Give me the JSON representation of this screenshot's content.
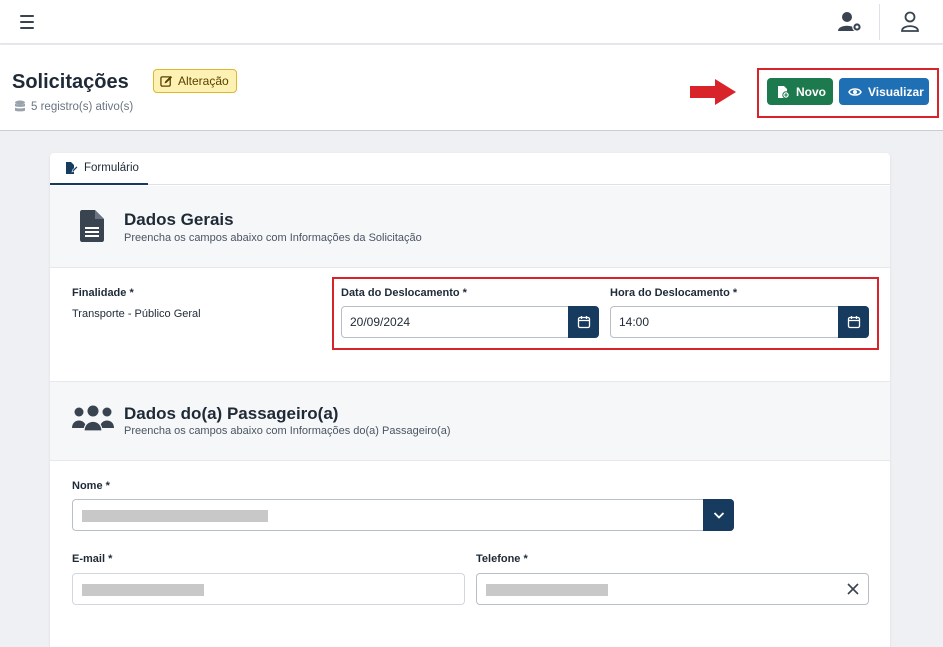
{
  "header": {
    "menu_icon": "hamburger-icon",
    "settings_icon": "user-gear-icon",
    "user_icon": "user-icon"
  },
  "page": {
    "title": "Solicitações",
    "badge_label": "Alteração",
    "records_info": "5 registro(s) ativo(s)",
    "actions": {
      "novo_label": "Novo",
      "visualizar_label": "Visualizar"
    }
  },
  "tabs": [
    {
      "label": "Formulário",
      "active": true
    }
  ],
  "dados_gerais": {
    "title": "Dados Gerais",
    "subtitle": "Preencha os campos abaixo com Informações da Solicitação",
    "finalidade_label": "Finalidade *",
    "finalidade_value": "Transporte - Público Geral",
    "data_label": "Data do Deslocamento *",
    "data_value": "20/09/2024",
    "hora_label": "Hora do Deslocamento *",
    "hora_value": "14:00"
  },
  "passageiro": {
    "title": "Dados do(a) Passageiro(a)",
    "subtitle": "Preencha os campos abaixo com Informações do(a) Passageiro(a)",
    "nome_label": "Nome *",
    "email_label": "E-mail *",
    "telefone_label": "Telefone *"
  },
  "colors": {
    "primary_dark": "#163b5f",
    "novo_green": "#1d7a4e",
    "visualizar_blue": "#1f6fb5",
    "highlight_red": "#d9232a",
    "badge_yellow": "#fdf1b3"
  }
}
